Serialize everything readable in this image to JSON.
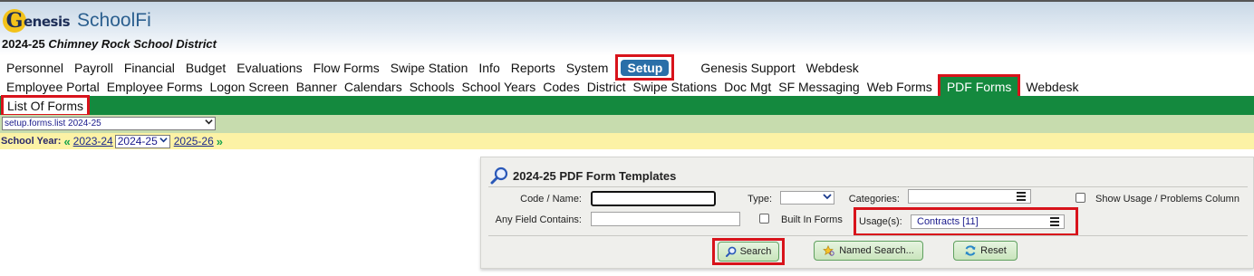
{
  "header": {
    "logo_g": "G",
    "logo_rest": "enesis",
    "app_name": "SchoolFi",
    "year_prefix": "2024-25",
    "district_name": "Chimney Rock School District"
  },
  "main_nav": {
    "items": [
      "Personnel",
      "Payroll",
      "Financial",
      "Budget",
      "Evaluations",
      "Flow Forms",
      "Swipe Station",
      "Info",
      "Reports",
      "System"
    ],
    "active": "Setup",
    "after": [
      "Genesis Support",
      "Webdesk"
    ]
  },
  "sub_nav": {
    "items": [
      "Employee Portal",
      "Employee Forms",
      "Logon Screen",
      "Banner",
      "Calendars",
      "Schools",
      "School Years",
      "Codes",
      "District",
      "Swipe Stations",
      "Doc Mgt",
      "SF Messaging",
      "Web Forms"
    ],
    "active": "PDF Forms",
    "after": [
      "Webdesk"
    ]
  },
  "tab": {
    "label": "List Of Forms"
  },
  "screen_select": {
    "value": "setup.forms.list 2024-25"
  },
  "year_bar": {
    "label": "School Year:",
    "prev": "2023-24",
    "current": "2024-25",
    "next": "2025-26"
  },
  "panel": {
    "title": "2024-25 PDF Form Templates",
    "code_name_label": "Code / Name:",
    "code_name_value": "",
    "any_field_label": "Any Field Contains:",
    "any_field_value": "",
    "type_label": "Type:",
    "type_value": "",
    "built_in_label": "Built In Forms",
    "categories_label": "Categories:",
    "categories_value": "",
    "usage_label": "Usage(s):",
    "usage_value": "Contracts [11]",
    "show_usage_label": "Show Usage / Problems Column",
    "search_button": "Search",
    "named_search_button": "Named Search...",
    "reset_button": "Reset"
  },
  "colors": {
    "setup_active": "#2a6fa8",
    "pdf_active": "#14893e",
    "highlight": "#d8131b",
    "year_bar": "#fcf2a5",
    "select_bar": "#c7dcae"
  }
}
